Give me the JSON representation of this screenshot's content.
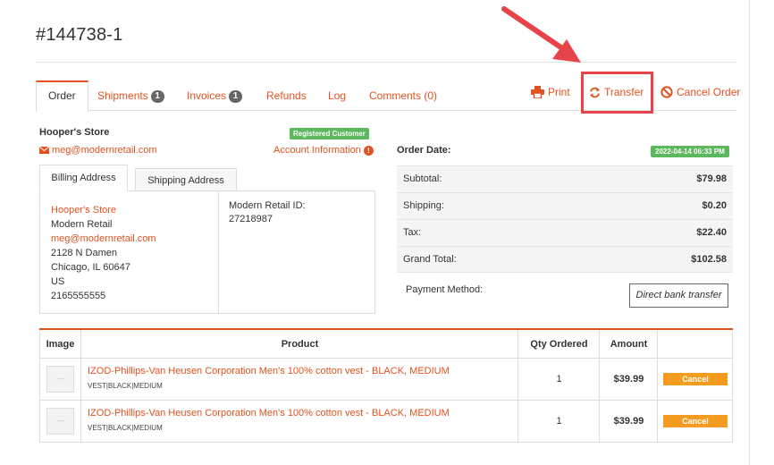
{
  "order": {
    "title": "#144738-1"
  },
  "tabs": [
    {
      "label": "Order",
      "badge": null
    },
    {
      "label": "Shipments",
      "badge": "1"
    },
    {
      "label": "Invoices",
      "badge": "1"
    },
    {
      "label": "Refunds",
      "badge": null
    },
    {
      "label": "Log",
      "badge": null
    },
    {
      "label": "Comments (0)",
      "badge": null
    }
  ],
  "actions": {
    "print": "Print",
    "transfer": "Transfer",
    "cancel_order": "Cancel Order"
  },
  "customer": {
    "store_name": "Hooper's Store",
    "type_badge": "Registered Customer",
    "email": "meg@modernretail.com",
    "account_info": "Account Information"
  },
  "address_tabs": {
    "billing": "Billing Address",
    "shipping": "Shipping Address"
  },
  "billing": {
    "name": "Hooper's Store",
    "company": "Modern Retail",
    "email": "meg@modernretail.com",
    "street": "2128 N Damen",
    "city_state_zip": "Chicago, IL 60647",
    "country": "US",
    "phone": "2165555555"
  },
  "modern_retail_id": {
    "label": "Modern Retail ID:",
    "value": "27218987"
  },
  "summary": {
    "order_date_label": "Order Date:",
    "order_date": "2022-04-14 06:33 PM",
    "rows": [
      {
        "label": "Subtotal:",
        "value": "$79.98"
      },
      {
        "label": "Shipping:",
        "value": "$0.20"
      },
      {
        "label": "Tax:",
        "value": "$22.40"
      },
      {
        "label": "Grand Total:",
        "value": "$102.58"
      }
    ],
    "payment_method_label": "Payment Method:",
    "payment_method": "Direct bank transfer"
  },
  "products": {
    "headers": {
      "image": "Image",
      "product": "Product",
      "qty": "Qty Ordered",
      "amount": "Amount"
    },
    "rows": [
      {
        "name": "IZOD-Phillips-Van Heusen Corporation Men's 100% cotton vest - BLACK, MEDIUM",
        "variant": "VEST|BLACK|MEDIUM",
        "qty": "1",
        "amount": "$39.99",
        "cancel": "Cancel"
      },
      {
        "name": "IZOD-Phillips-Van Heusen Corporation Men's 100% cotton vest - BLACK, MEDIUM",
        "variant": "VEST|BLACK|MEDIUM",
        "qty": "1",
        "amount": "$39.99",
        "cancel": "Cancel"
      }
    ]
  },
  "colors": {
    "accent": "#e2521f",
    "success": "#5cb85c",
    "cancel_button": "#f39c1f",
    "annotation": "#e64449"
  },
  "icons": {
    "email": "envelope-icon",
    "info": "info-icon",
    "print": "printer-icon",
    "transfer": "refresh-icon",
    "cancel": "ban-icon",
    "annotation": "arrow-annotation"
  }
}
